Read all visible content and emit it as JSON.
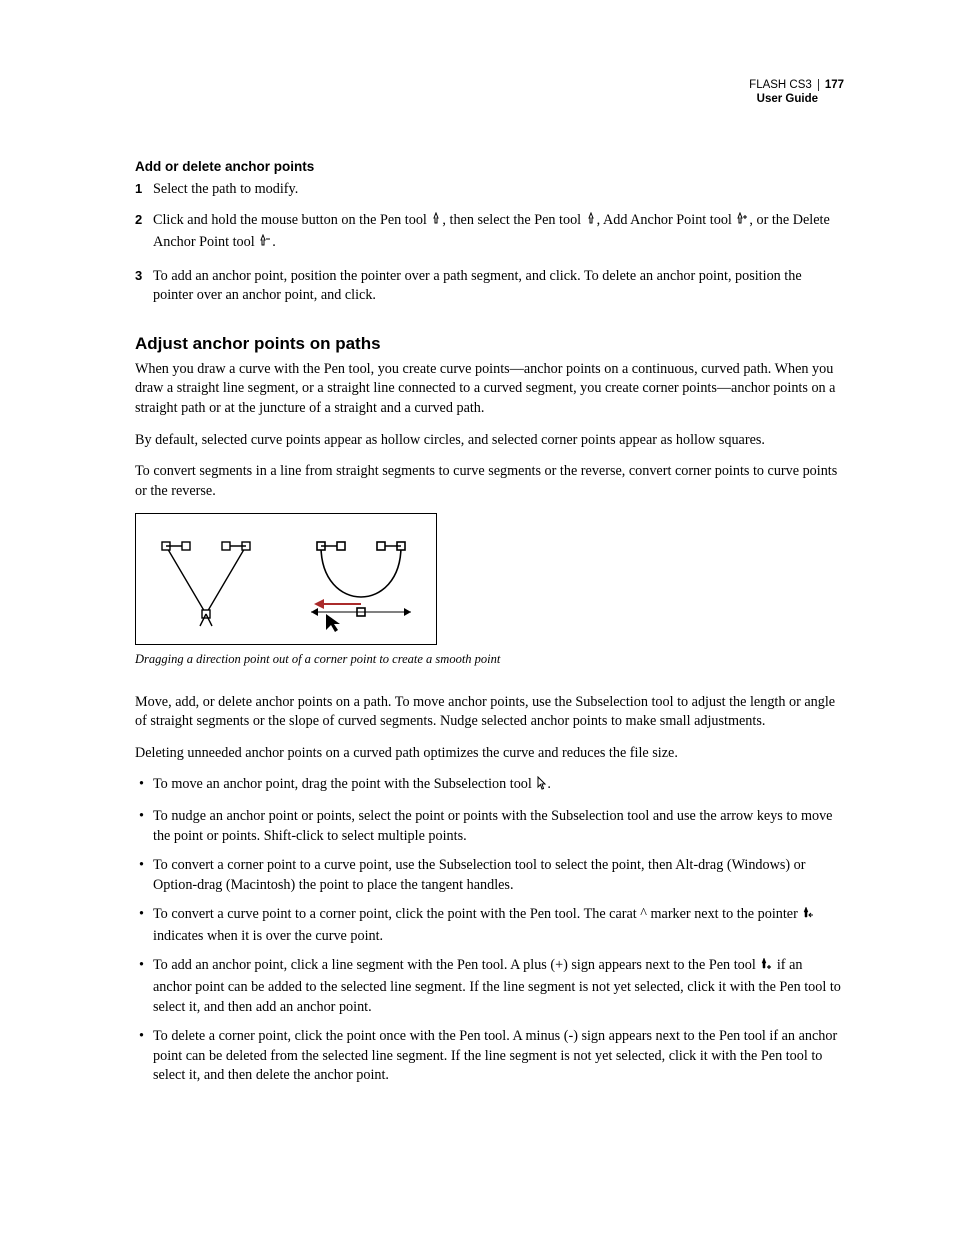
{
  "header": {
    "product": "FLASH CS3",
    "page_number": "177",
    "doc_title": "User Guide"
  },
  "section1": {
    "heading": "Add or delete anchor points",
    "steps": {
      "s1": "Select the path to modify.",
      "s2a": "Click and hold the mouse button on the Pen tool ",
      "s2b": ", then select the Pen tool ",
      "s2c": ", Add Anchor Point tool ",
      "s2d": ", or the Delete Anchor Point tool ",
      "s2e": ".",
      "s3": "To add an anchor point, position the pointer over a path segment, and click. To delete an anchor point, position the pointer over an anchor point, and click."
    }
  },
  "section2": {
    "heading": "Adjust anchor points on paths",
    "p1": "When you draw a curve with the Pen tool, you create curve points—anchor points on a continuous, curved path. When you draw a straight line segment, or a straight line connected to a curved segment, you create corner points—anchor points on a straight path or at the juncture of a straight and a curved path.",
    "p2": "By default, selected curve points appear as hollow circles, and selected corner points appear as hollow squares.",
    "p3": "To convert segments in a line from straight segments to curve segments or the reverse, convert corner points to curve points or the reverse.",
    "caption": "Dragging a direction point out of a corner point to create a smooth point",
    "p4": "Move, add, or delete anchor points on a path. To move anchor points, use the Subselection tool to adjust the length or angle of straight segments or the slope of curved segments. Nudge selected anchor points to make small adjustments.",
    "p5": "Deleting unneeded anchor points on a curved path optimizes the curve and reduces the file size.",
    "bullets": {
      "b1a": "To move an anchor point, drag the point with the Subselection tool ",
      "b1b": ".",
      "b2": "To nudge an anchor point or points, select the point or points with the Subselection tool and use the arrow keys to move the point or points. Shift-click to select multiple points.",
      "b3": "To convert a corner point to a curve point, use the Subselection tool to select the point, then Alt-drag (Windows) or Option-drag (Macintosh) the point to place the tangent handles.",
      "b4a": "To convert a curve point to a corner point, click the point with the Pen tool. The carat ^ marker next to the pointer ",
      "b4b": " indicates when it is over the curve point.",
      "b5a": "To add an anchor point, click a line segment with the Pen tool. A plus (+) sign appears next to the Pen tool ",
      "b5b": " if an anchor point can be added to the selected line segment. If the line segment is not yet selected, click it with the Pen tool to select it, and then add an anchor point.",
      "b6": "To delete a corner point, click the point once with the Pen tool. A minus (-) sign appears next to the Pen tool if an anchor point can be deleted from the selected line segment. If the line segment is not yet selected, click it with the Pen tool to select it, and then delete the anchor point."
    }
  }
}
